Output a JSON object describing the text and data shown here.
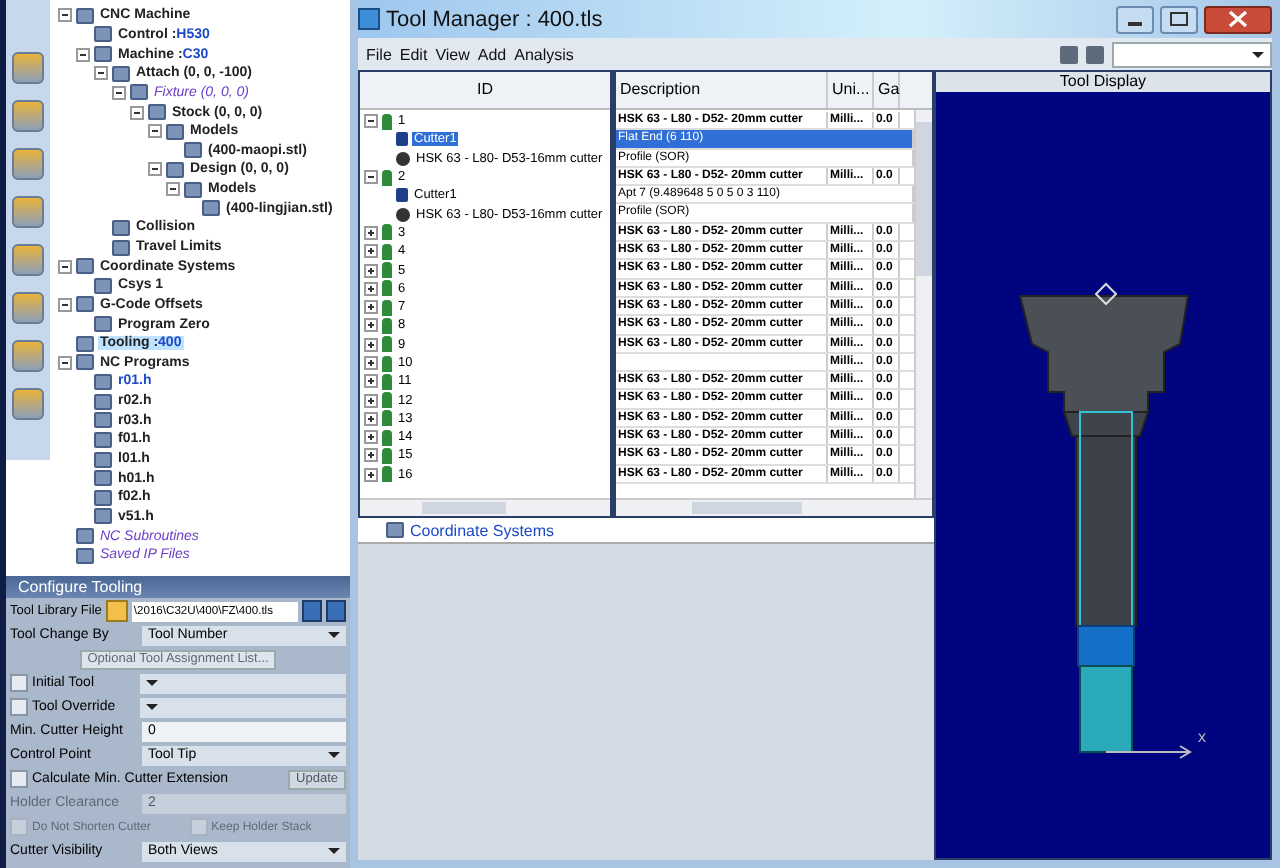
{
  "project_tree": [
    {
      "label": "CNC Machine",
      "kind": "normal",
      "selected": false,
      "children": [
        {
          "label": "Control :",
          "value": "H530",
          "kind": "normal",
          "selected": false
        },
        {
          "label": "Machine :",
          "value": "C30",
          "kind": "normal",
          "selected": false,
          "children": [
            {
              "label": "Attach (0, 0, -100)",
              "kind": "normal",
              "selected": false,
              "children": [
                {
                  "label": "Fixture (0, 0, 0)",
                  "kind": "virtual",
                  "selected": false,
                  "children": [
                    {
                      "label": "Stock (0, 0, 0)",
                      "kind": "normal",
                      "selected": false,
                      "children": [
                        {
                          "label": "Models",
                          "kind": "normal",
                          "selected": false,
                          "children": [
                            {
                              "label": "(400-maopi.stl)",
                              "kind": "normal",
                              "selected": false
                            }
                          ]
                        },
                        {
                          "label": "Design (0, 0, 0)",
                          "kind": "normal",
                          "selected": false,
                          "children": [
                            {
                              "label": "Models",
                              "kind": "normal",
                              "selected": false,
                              "children": [
                                {
                                  "label": "(400-lingjian.stl)",
                                  "kind": "normal",
                                  "selected": false
                                }
                              ]
                            }
                          ]
                        }
                      ]
                    }
                  ]
                }
              ]
            },
            {
              "label": "Collision",
              "kind": "normal",
              "selected": false
            },
            {
              "label": "Travel Limits",
              "kind": "normal",
              "selected": false
            }
          ]
        }
      ]
    },
    {
      "label": "Coordinate Systems",
      "kind": "normal",
      "selected": false,
      "children": [
        {
          "label": "Csys 1",
          "kind": "normal",
          "selected": false
        }
      ]
    },
    {
      "label": "G-Code Offsets",
      "kind": "normal",
      "selected": false,
      "children": [
        {
          "label": "Program Zero",
          "kind": "normal",
          "selected": false
        }
      ]
    },
    {
      "label": "Tooling :",
      "value": "400",
      "kind": "normal",
      "selected": true
    },
    {
      "label": "NC Programs",
      "kind": "normal",
      "selected": false,
      "children": [
        {
          "label": "r01.h",
          "kind": "active",
          "selected": false
        },
        {
          "label": "r02.h",
          "kind": "normal",
          "selected": false
        },
        {
          "label": "r03.h",
          "kind": "normal",
          "selected": false
        },
        {
          "label": "f01.h",
          "kind": "normal",
          "selected": false
        },
        {
          "label": "l01.h",
          "kind": "normal",
          "selected": false
        },
        {
          "label": "h01.h",
          "kind": "normal",
          "selected": false
        },
        {
          "label": "f02.h",
          "kind": "normal",
          "selected": false
        },
        {
          "label": "v51.h",
          "kind": "normal",
          "selected": false
        }
      ]
    },
    {
      "label": "NC Subroutines",
      "kind": "virtual",
      "selected": false
    },
    {
      "label": "Saved IP Files",
      "kind": "virtual",
      "selected": false
    }
  ],
  "config": {
    "title": "Configure Tooling",
    "fields": [
      {
        "kind": "file",
        "label": "Tool Library File",
        "value": "\\2016\\C32U\\400\\FZ\\400.tls"
      },
      {
        "kind": "select",
        "label": "Tool Change By",
        "value": "Tool Number"
      },
      {
        "kind": "button",
        "label": "Optional Tool Assignment List...",
        "disabled": true
      },
      {
        "kind": "check-select",
        "label": "Initial Tool",
        "checked": false
      },
      {
        "kind": "check-select",
        "label": "Tool Override",
        "checked": false
      },
      {
        "kind": "text",
        "label": "Min. Cutter Height",
        "value": "0",
        "disabled": false
      },
      {
        "kind": "select",
        "label": "Control Point",
        "value": "Tool Tip"
      },
      {
        "kind": "check-button",
        "label": "Calculate Min. Cutter Extension",
        "checked": false,
        "button": "Update"
      },
      {
        "kind": "text",
        "label": "Holder Clearance",
        "value": "2",
        "disabled": true
      },
      {
        "kind": "check-pair",
        "items": [
          {
            "label": "Do Not Shorten Cutter",
            "checked": false,
            "disabled": true
          },
          {
            "label": "Keep Holder Stack",
            "checked": false,
            "disabled": true
          }
        ]
      },
      {
        "kind": "select",
        "label": "Cutter Visibility",
        "value": "Both Views"
      }
    ]
  },
  "window": {
    "title": "Tool Manager : 400.tls",
    "menu": [
      "File",
      "Edit",
      "View",
      "Add",
      "Analysis"
    ]
  },
  "tool_tree": {
    "header": "ID",
    "tools": [
      {
        "label": "1",
        "expanded": true,
        "selected": false,
        "children": [
          {
            "label": "Cutter1",
            "kind": "cutter",
            "selected": true
          },
          {
            "label": "HSK 63 - L80- D53-16mm cutter",
            "kind": "holder",
            "selected": false
          }
        ]
      },
      {
        "label": "2",
        "expanded": true,
        "selected": false,
        "children": [
          {
            "label": "Cutter1",
            "kind": "cutter",
            "selected": false
          },
          {
            "label": "HSK 63 - L80- D53-16mm cutter",
            "kind": "holder",
            "selected": false
          }
        ]
      },
      {
        "label": "3",
        "expanded": false,
        "selected": false
      },
      {
        "label": "4",
        "expanded": false,
        "selected": false
      },
      {
        "label": "5",
        "expanded": false,
        "selected": false
      },
      {
        "label": "6",
        "expanded": false,
        "selected": false
      },
      {
        "label": "7",
        "expanded": false,
        "selected": false
      },
      {
        "label": "8",
        "expanded": false,
        "selected": false
      },
      {
        "label": "9",
        "expanded": false,
        "selected": false
      },
      {
        "label": "10",
        "expanded": false,
        "selected": false
      },
      {
        "label": "11",
        "expanded": false,
        "selected": false
      },
      {
        "label": "12",
        "expanded": false,
        "selected": false
      },
      {
        "label": "13",
        "expanded": false,
        "selected": false
      },
      {
        "label": "14",
        "expanded": false,
        "selected": false
      },
      {
        "label": "15",
        "expanded": false,
        "selected": false
      },
      {
        "label": "16",
        "expanded": false,
        "selected": false
      }
    ]
  },
  "table": {
    "columns": [
      "Description",
      "Uni...",
      "Ga"
    ],
    "rows": [
      {
        "kind": "tool",
        "description": "HSK 63 - L80 - D52- 20mm cutter",
        "unit": "Milli...",
        "ga": "0.0",
        "selected": false
      },
      {
        "kind": "part",
        "description": "Flat End (6 110)",
        "selected": true
      },
      {
        "kind": "part",
        "description": "Profile (SOR)",
        "selected": false
      },
      {
        "kind": "tool",
        "description": "HSK 63 - L80 - D52- 20mm cutter",
        "unit": "Milli...",
        "ga": "0.0",
        "selected": false
      },
      {
        "kind": "part",
        "description": "Apt 7 (9.489648 5 0 5 0 3 110)",
        "selected": false
      },
      {
        "kind": "part",
        "description": "Profile (SOR)",
        "selected": false
      },
      {
        "kind": "tool",
        "description": "HSK 63 - L80 - D52- 20mm cutter",
        "unit": "Milli...",
        "ga": "0.0",
        "selected": false
      },
      {
        "kind": "tool",
        "description": "HSK 63 - L80 - D52- 20mm cutter",
        "unit": "Milli...",
        "ga": "0.0",
        "selected": false
      },
      {
        "kind": "tool",
        "description": "HSK 63 - L80 - D52- 20mm cutter",
        "unit": "Milli...",
        "ga": "0.0",
        "selected": false
      },
      {
        "kind": "tool",
        "description": "HSK 63 - L80 - D52- 20mm cutter",
        "unit": "Milli...",
        "ga": "0.0",
        "selected": false
      },
      {
        "kind": "tool",
        "description": "HSK 63 - L80 - D52- 20mm cutter",
        "unit": "Milli...",
        "ga": "0.0",
        "selected": false
      },
      {
        "kind": "tool",
        "description": "HSK 63 - L80 - D52- 20mm cutter",
        "unit": "Milli...",
        "ga": "0.0",
        "selected": false
      },
      {
        "kind": "tool",
        "description": "HSK 63 - L80 - D52- 20mm cutter",
        "unit": "Milli...",
        "ga": "0.0",
        "selected": false
      },
      {
        "kind": "tool",
        "description": "",
        "unit": "Milli...",
        "ga": "0.0",
        "selected": false
      },
      {
        "kind": "tool",
        "description": "HSK 63 - L80 - D52- 20mm cutter",
        "unit": "Milli...",
        "ga": "0.0",
        "selected": false
      },
      {
        "kind": "tool",
        "description": "HSK 63 - L80 - D52- 20mm cutter",
        "unit": "Milli...",
        "ga": "0.0",
        "selected": false
      },
      {
        "kind": "tool",
        "description": "HSK 63 - L80 - D52- 20mm cutter",
        "unit": "Milli...",
        "ga": "0.0",
        "selected": false
      },
      {
        "kind": "tool",
        "description": "HSK 63 - L80 - D52- 20mm cutter",
        "unit": "Milli...",
        "ga": "0.0",
        "selected": false
      },
      {
        "kind": "tool",
        "description": "HSK 63 - L80 - D52- 20mm cutter",
        "unit": "Milli...",
        "ga": "0.0",
        "selected": false
      },
      {
        "kind": "tool",
        "description": "HSK 63 - L80 - D52- 20mm cutter",
        "unit": "Milli...",
        "ga": "0.0",
        "selected": false
      }
    ]
  },
  "lower_tree": {
    "label": "Coordinate Systems"
  },
  "display": {
    "title": "Tool Display",
    "axis_label": "x"
  }
}
